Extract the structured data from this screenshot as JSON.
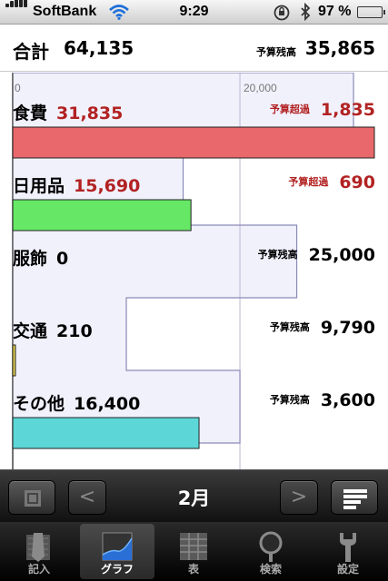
{
  "status_bar": {
    "carrier": "SoftBank",
    "time": "9:29",
    "battery": "97 %",
    "battery_level": 0.97
  },
  "summary": {
    "total_label": "合計",
    "total_value": "64,135",
    "remain_label": "予算残高",
    "remain_value": "35,865"
  },
  "axis": {
    "tick_0": "0",
    "tick_1": "20,000"
  },
  "chart_data": {
    "type": "bar",
    "orientation": "horizontal",
    "categories": [
      "食費",
      "日用品",
      "服飾",
      "交通",
      "その他"
    ],
    "values": [
      31835,
      15690,
      0,
      210,
      16400
    ],
    "budgets": [
      30000,
      15000,
      25000,
      10000,
      20000
    ],
    "bar_colors": [
      "#e8686b",
      "#66e866",
      "#dddddd",
      "#e6d24a",
      "#5cd6d6"
    ],
    "xticks": [
      "0",
      "20,000"
    ],
    "xlim": [
      0,
      31835
    ],
    "rows": [
      {
        "category": "食費",
        "amount": "31,835",
        "status": "予算超過",
        "status_value": "1,835",
        "over": true
      },
      {
        "category": "日用品",
        "amount": "15,690",
        "status": "予算超過",
        "status_value": "690",
        "over": true
      },
      {
        "category": "服飾",
        "amount": "0",
        "status": "予算残高",
        "status_value": "25,000",
        "over": false
      },
      {
        "category": "交通",
        "amount": "210",
        "status": "予算残高",
        "status_value": "9,790",
        "over": false
      },
      {
        "category": "その他",
        "amount": "16,400",
        "status": "予算残高",
        "status_value": "3,600",
        "over": false
      }
    ]
  },
  "month_nav": {
    "month": "2月",
    "prev_glyph": "<",
    "next_glyph": ">"
  },
  "tabs": [
    {
      "label": "記入",
      "icon": "pencil-icon",
      "active": false
    },
    {
      "label": "グラフ",
      "icon": "graph-icon",
      "active": true
    },
    {
      "label": "表",
      "icon": "table-icon",
      "active": false
    },
    {
      "label": "検索",
      "icon": "magnifier-icon",
      "active": false
    },
    {
      "label": "設定",
      "icon": "wrench-icon",
      "active": false
    }
  ]
}
